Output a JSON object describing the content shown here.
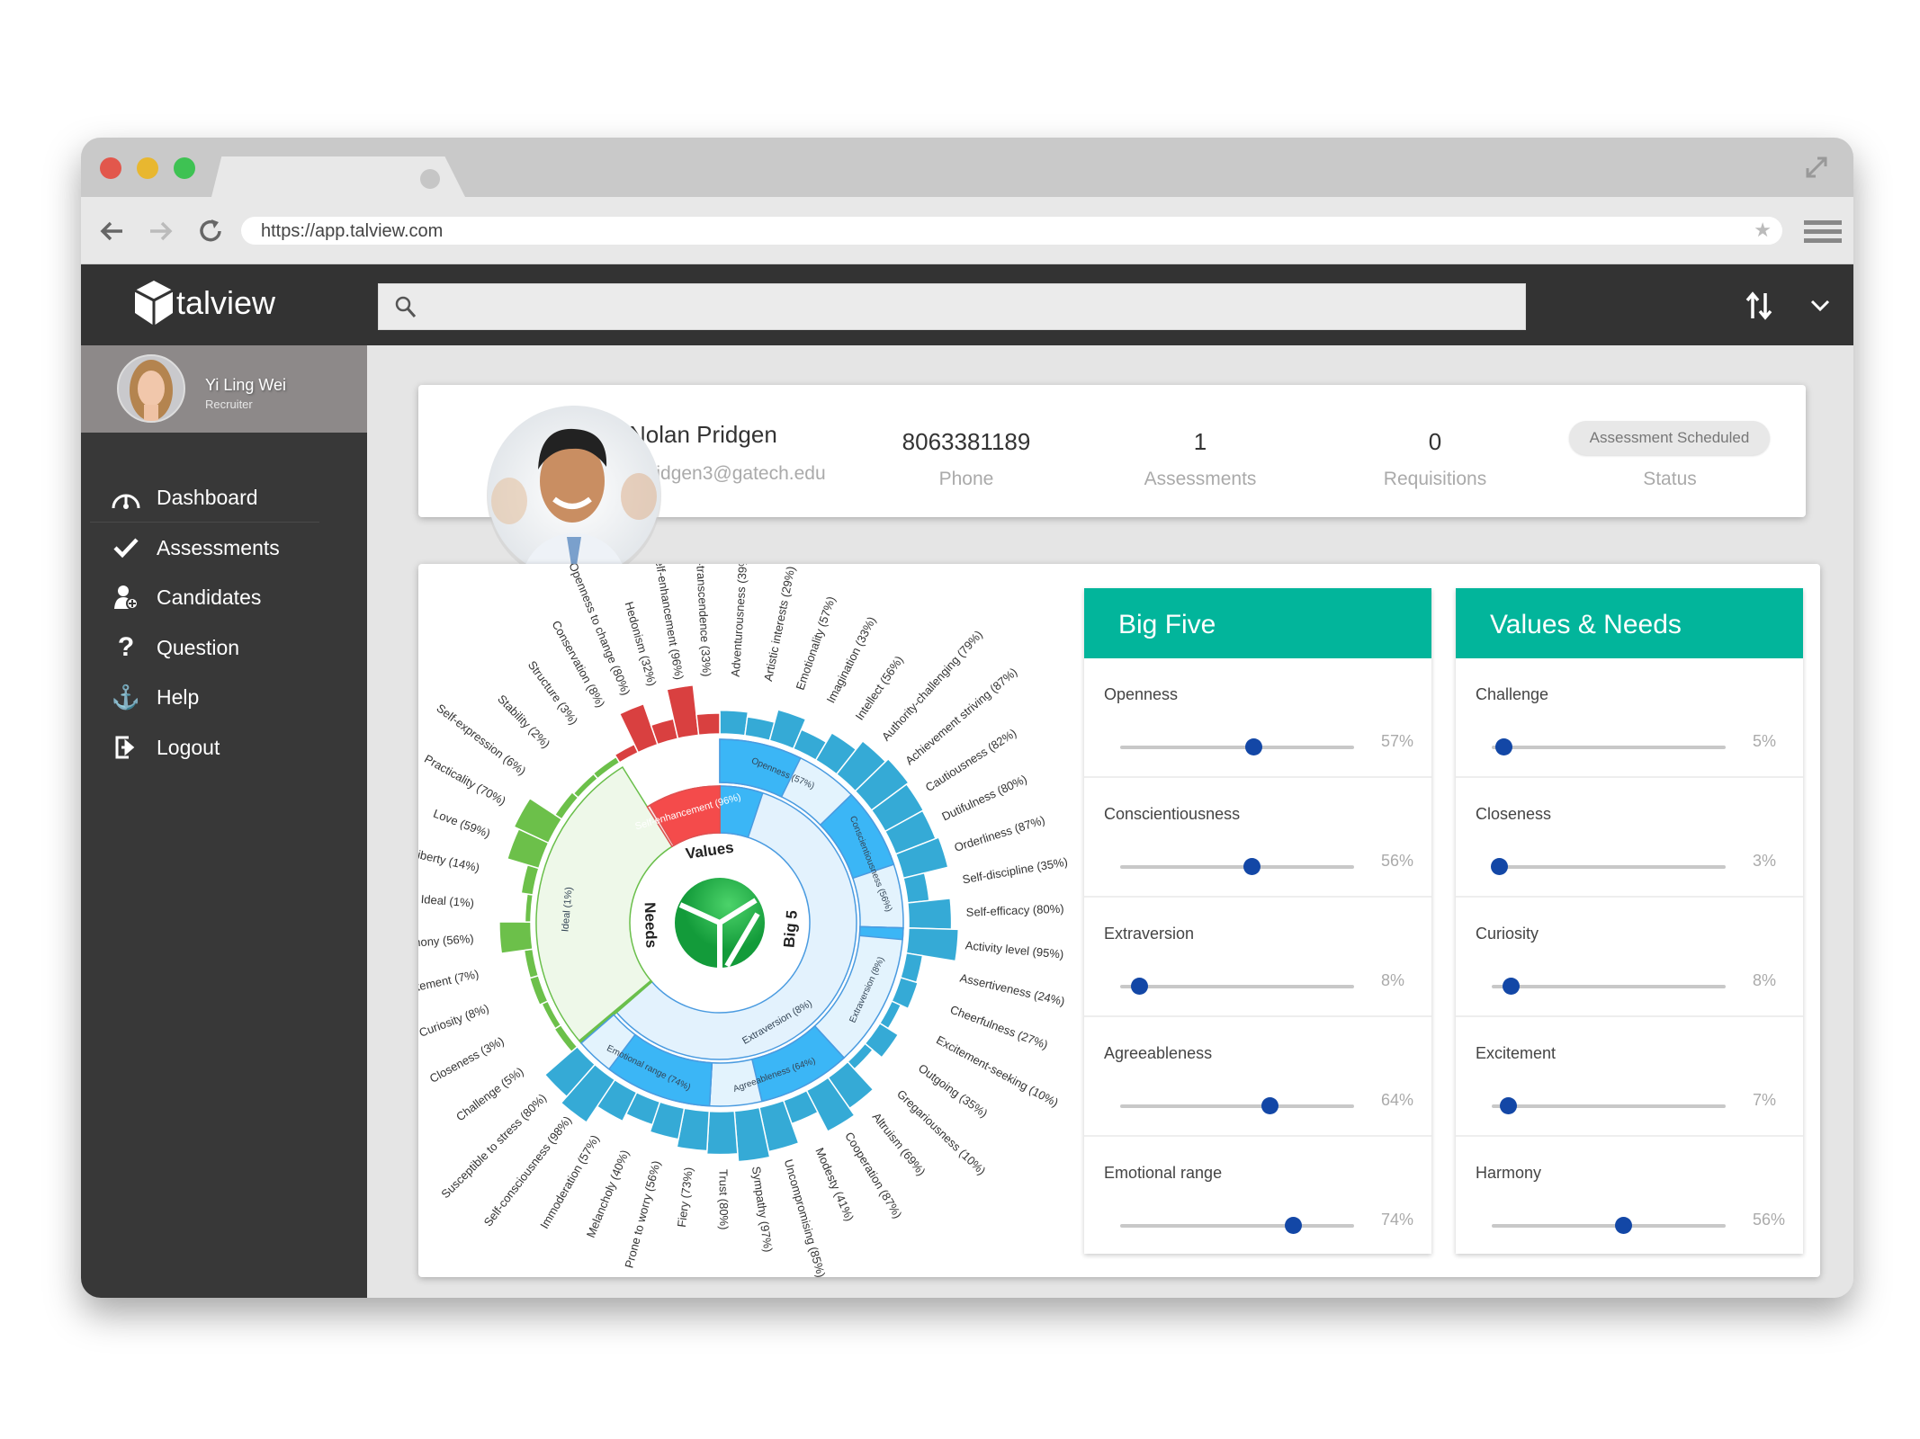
{
  "browser": {
    "url": "https://app.talview.com"
  },
  "app": {
    "logo_text": "talview",
    "search_placeholder": ""
  },
  "user": {
    "name": "Yi Ling Wei",
    "role": "Recruiter"
  },
  "sidebar": {
    "items": [
      {
        "label": "Dashboard",
        "icon": "gauge-icon"
      },
      {
        "label": "Assessments",
        "icon": "check-icon"
      },
      {
        "label": "Candidates",
        "icon": "add-user-icon"
      },
      {
        "label": "Question",
        "icon": "question-icon"
      },
      {
        "label": "Help",
        "icon": "anchor-icon"
      },
      {
        "label": "Logout",
        "icon": "logout-icon"
      }
    ]
  },
  "candidate": {
    "name": "Nolan Pridgen",
    "email": "npridgen3@gatech.edu",
    "phone": "8063381189",
    "phone_label": "Phone",
    "assessments": "1",
    "assessments_label": "Assessments",
    "requisitions": "0",
    "requisitions_label": "Requisitions",
    "status": "Assessment Scheduled",
    "status_label": "Status"
  },
  "big_five": {
    "title": "Big Five",
    "items": [
      {
        "label": "Openness",
        "value": 57,
        "display": "57%"
      },
      {
        "label": "Conscientiousness",
        "value": 56,
        "display": "56%"
      },
      {
        "label": "Extraversion",
        "value": 8,
        "display": "8%"
      },
      {
        "label": "Agreeableness",
        "value": 64,
        "display": "64%"
      },
      {
        "label": "Emotional range",
        "value": 74,
        "display": "74%"
      }
    ]
  },
  "values_needs": {
    "title": "Values & Needs",
    "items": [
      {
        "label": "Challenge",
        "value": 5,
        "display": "5%"
      },
      {
        "label": "Closeness",
        "value": 3,
        "display": "3%"
      },
      {
        "label": "Curiosity",
        "value": 8,
        "display": "8%"
      },
      {
        "label": "Excitement",
        "value": 7,
        "display": "7%"
      },
      {
        "label": "Harmony",
        "value": 56,
        "display": "56%"
      }
    ]
  },
  "colors": {
    "accent": "#02b59b",
    "slider": "#1347a6",
    "big5": "#35aad6",
    "big5_fill": "#3bb6f6",
    "needs": "#6cc04a",
    "values": "#d94040"
  },
  "chart_data": {
    "type": "sunburst",
    "groups": [
      {
        "name": "Big 5",
        "ring_label": "Extraversion",
        "ring_value": 8,
        "traits": [
          {
            "name": "Openness",
            "value": 57,
            "facets": [
              [
                "Adventurousness",
                39
              ],
              [
                "Artistic interests",
                29
              ],
              [
                "Emotionality",
                57
              ],
              [
                "Imagination",
                33
              ],
              [
                "Intellect",
                56
              ],
              [
                "Authority-challenging",
                79
              ]
            ]
          },
          {
            "name": "Conscientiousness",
            "value": 56,
            "facets": [
              [
                "Achievement striving",
                87
              ],
              [
                "Cautiousness",
                82
              ],
              [
                "Dutifulness",
                80
              ],
              [
                "Orderliness",
                87
              ],
              [
                "Self-discipline",
                35
              ],
              [
                "Self-efficacy",
                80
              ]
            ]
          },
          {
            "name": "Extraversion",
            "value": 8,
            "facets": [
              [
                "Activity level",
                95
              ],
              [
                "Assertiveness",
                24
              ],
              [
                "Cheerfulness",
                27
              ],
              [
                "Excitement-seeking",
                10
              ],
              [
                "Outgoing",
                35
              ],
              [
                "Gregariousness",
                10
              ]
            ]
          },
          {
            "name": "Agreeableness",
            "value": 64,
            "facets": [
              [
                "Altruism",
                69
              ],
              [
                "Cooperation",
                87
              ],
              [
                "Modesty",
                41
              ],
              [
                "Uncompromising",
                85
              ],
              [
                "Sympathy",
                97
              ],
              [
                "Trust",
                80
              ]
            ]
          },
          {
            "name": "Emotional range",
            "value": 74,
            "facets": [
              [
                "Fiery",
                73
              ],
              [
                "Prone to worry",
                56
              ],
              [
                "Melancholy",
                40
              ],
              [
                "Immoderation",
                57
              ],
              [
                "Self-consciousness",
                98
              ],
              [
                "Susceptible to stress",
                80
              ]
            ]
          }
        ]
      },
      {
        "name": "Needs",
        "ring_label": "Ideal",
        "ring_value": 1,
        "facets": [
          [
            "Challenge",
            5
          ],
          [
            "Closeness",
            3
          ],
          [
            "Curiosity",
            8
          ],
          [
            "Excitement",
            7
          ],
          [
            "Harmony",
            56
          ],
          [
            "Ideal",
            1
          ],
          [
            "Liberty",
            14
          ],
          [
            "Love",
            59
          ],
          [
            "Practicality",
            70
          ],
          [
            "Self-expression",
            6
          ],
          [
            "Stability",
            2
          ],
          [
            "Structure",
            3
          ]
        ]
      },
      {
        "name": "Values",
        "ring_label": "Self-enhancement",
        "ring_value": 96,
        "facets": [
          [
            "Conservation",
            8
          ],
          [
            "Openness to change",
            80
          ],
          [
            "Hedonism",
            32
          ],
          [
            "Self-enhancement",
            96
          ],
          [
            "Self-transcendence",
            33
          ]
        ]
      }
    ]
  }
}
